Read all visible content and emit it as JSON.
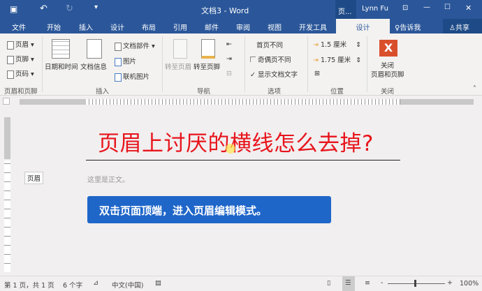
{
  "titlebar": {
    "title": "文档3 - Word",
    "context": "页...",
    "user": "Lynn Fu"
  },
  "tabs": [
    {
      "label": "文件"
    },
    {
      "label": "开始"
    },
    {
      "label": "插入"
    },
    {
      "label": "设计"
    },
    {
      "label": "布局"
    },
    {
      "label": "引用"
    },
    {
      "label": "邮件"
    },
    {
      "label": "审阅"
    },
    {
      "label": "视图"
    },
    {
      "label": "开发工具"
    },
    {
      "label": "设计"
    }
  ],
  "tell_me": "告诉我",
  "share": "共享",
  "ribbon": {
    "hf": {
      "header": "页眉",
      "footer": "页脚",
      "page_number": "页码",
      "group": "页眉和页脚"
    },
    "insert": {
      "datetime": "日期和时间",
      "docinfo": "文档信息",
      "parts": "文档部件",
      "picture": "图片",
      "online_picture": "联机图片",
      "group": "插入"
    },
    "nav": {
      "goto_header": "转至页眉",
      "goto_footer": "转至页脚",
      "group": "导航"
    },
    "options": {
      "first_diff": "首页不同",
      "odd_even": "奇偶页不同",
      "show_text": "显示文档文字",
      "group": "选项"
    },
    "position": {
      "header_pos": "1.5 厘米",
      "footer_pos": "1.75 厘米",
      "group": "位置"
    },
    "close": {
      "label1": "关闭",
      "label2": "页眉和页脚",
      "group": "关闭"
    }
  },
  "document": {
    "heading": "页眉上讨厌的横线怎么去掉?",
    "header_tag": "页眉",
    "body": "这里是正文。",
    "callout": "双击页面顶端，进入页眉编辑模式。"
  },
  "status": {
    "page": "第 1 页，共 1 页",
    "words": "6 个字",
    "lang": "中文(中国)",
    "zoom": "100%"
  },
  "colors": {
    "accent": "#2b579a",
    "heading": "#e8141c",
    "callout": "#1f66c9"
  }
}
